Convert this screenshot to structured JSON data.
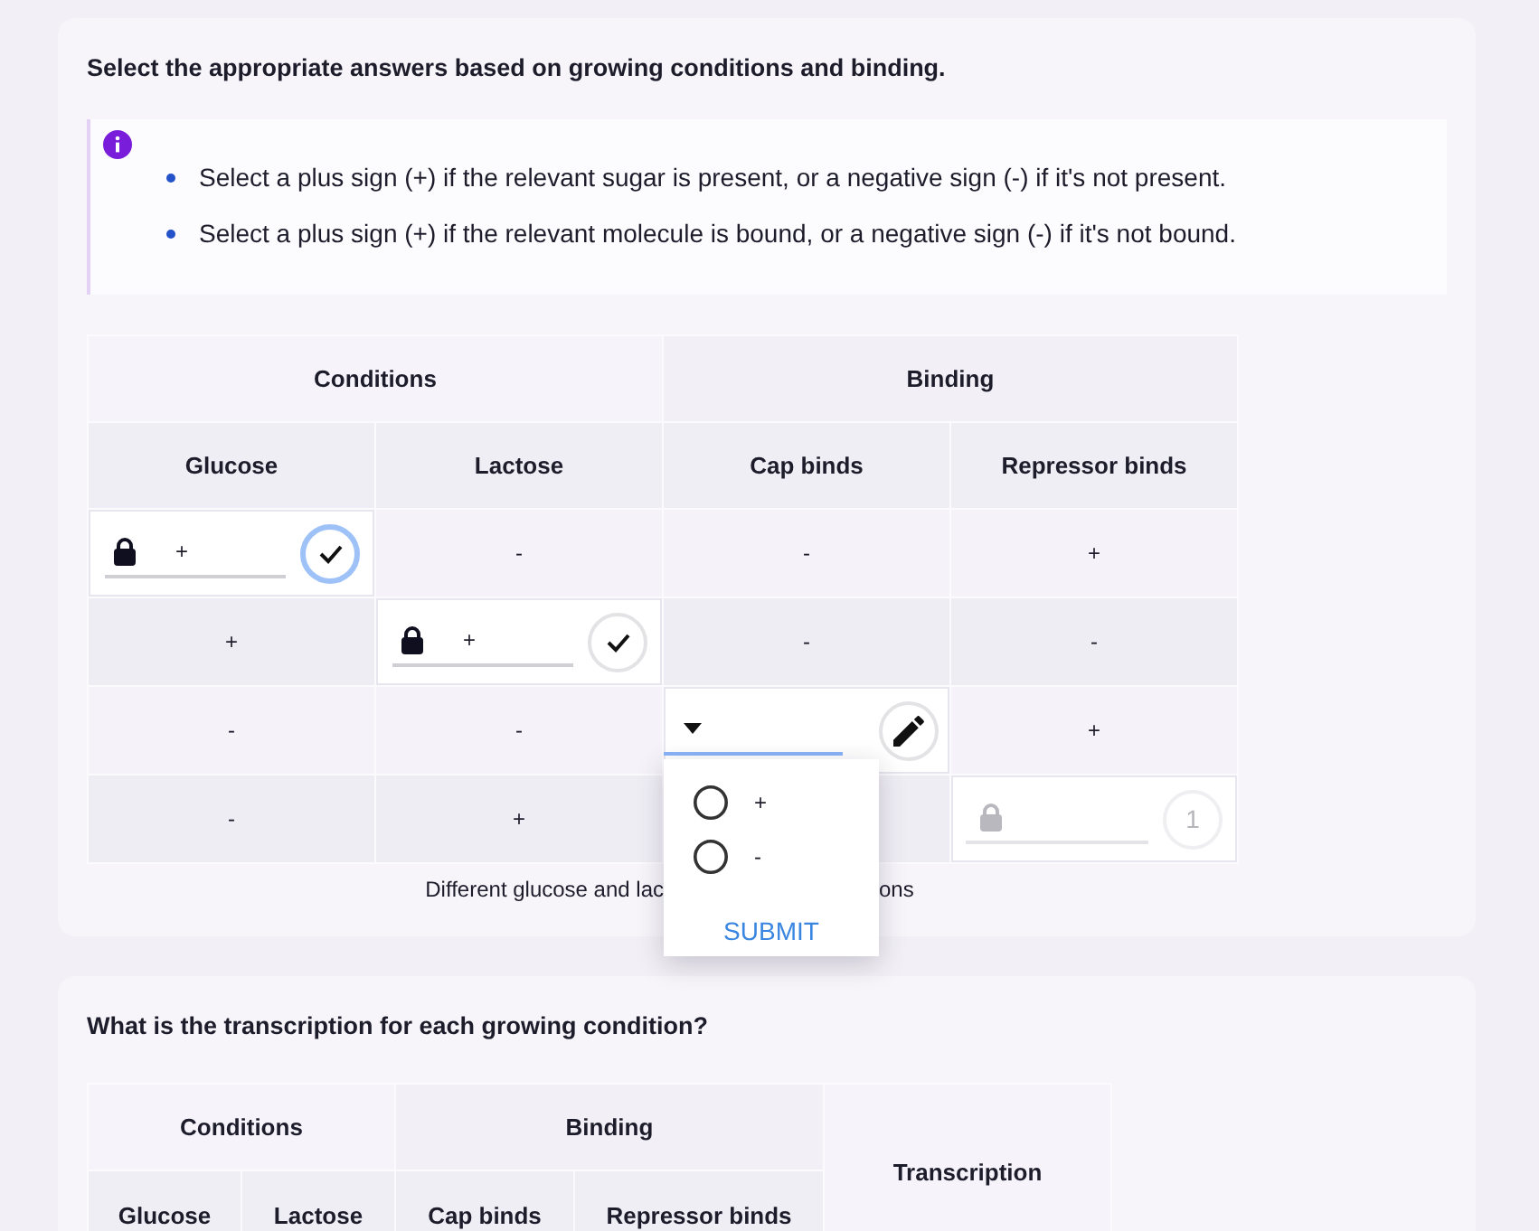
{
  "questions": [
    {
      "title": "Select the appropriate answers based on growing conditions and binding.",
      "info": {
        "bullets": [
          "Select a plus sign (+) if the relevant sugar is present, or a negative sign (-) if it's not present.",
          "Select a plus sign (+) if the relevant molecule is bound, or a negative sign (-) if it's not bound."
        ]
      },
      "table": {
        "column_groups": [
          {
            "label": "Conditions",
            "columns": [
              "Glucose",
              "Lactose"
            ]
          },
          {
            "label": "Binding",
            "columns": [
              "Cap binds",
              "Repressor binds"
            ]
          }
        ],
        "rows": [
          {
            "cells": [
              {
                "kind": "submitted",
                "value": "+",
                "focused": true
              },
              {
                "kind": "text",
                "value": "-"
              },
              {
                "kind": "text",
                "value": "-"
              },
              {
                "kind": "text",
                "value": "+"
              }
            ]
          },
          {
            "cells": [
              {
                "kind": "text",
                "value": "+"
              },
              {
                "kind": "submitted",
                "value": "+",
                "focused": false
              },
              {
                "kind": "text",
                "value": "-"
              },
              {
                "kind": "text",
                "value": "-"
              }
            ]
          },
          {
            "cells": [
              {
                "kind": "text",
                "value": "-"
              },
              {
                "kind": "text",
                "value": "-"
              },
              {
                "kind": "dropdown",
                "expanded": true
              },
              {
                "kind": "text",
                "value": "+"
              }
            ]
          },
          {
            "cells": [
              {
                "kind": "text",
                "value": "-"
              },
              {
                "kind": "text",
                "value": "+"
              },
              {
                "kind": "empty"
              },
              {
                "kind": "inactive",
                "attempts": "1"
              }
            ]
          }
        ],
        "dropdown_menu": {
          "options": [
            {
              "label": "+",
              "selected": false
            },
            {
              "label": "-",
              "selected": false
            }
          ],
          "submit": "SUBMIT"
        },
        "caption_parts": [
          "Different glucose and lac",
          "ons"
        ]
      }
    },
    {
      "title": "What is the transcription for each growing condition?",
      "table": {
        "column_groups": [
          {
            "label": "Conditions",
            "columns": [
              "Glucose",
              "Lactose"
            ]
          },
          {
            "label": "Binding",
            "columns": [
              "Cap binds",
              "Repressor binds"
            ]
          }
        ],
        "extra_column": {
          "label": "Transcription"
        }
      }
    }
  ]
}
